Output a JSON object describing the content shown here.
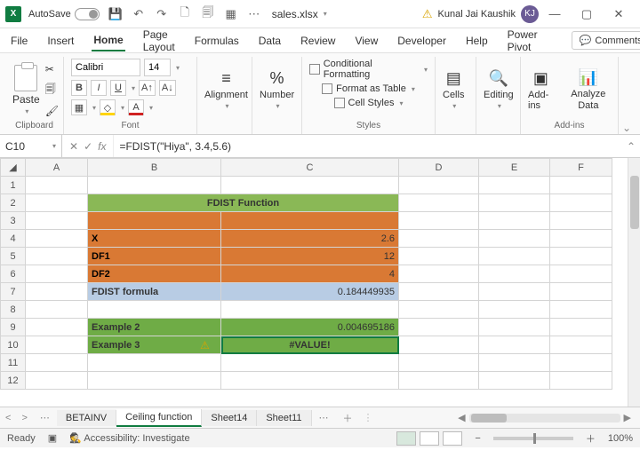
{
  "titlebar": {
    "autosave": "AutoSave",
    "autosave_state": "Off",
    "filename": "sales.xlsx",
    "user_name": "Kunal Jai Kaushik",
    "user_initials": "KJ"
  },
  "tabs": {
    "file": "File",
    "insert": "Insert",
    "home": "Home",
    "pagelayout": "Page Layout",
    "formulas": "Formulas",
    "data": "Data",
    "review": "Review",
    "view": "View",
    "developer": "Developer",
    "help": "Help",
    "powerpivot": "Power Pivot",
    "comments": "Comments"
  },
  "ribbon": {
    "clipboard": {
      "paste": "Paste",
      "label": "Clipboard"
    },
    "font": {
      "name": "Calibri",
      "size": "14",
      "label": "Font"
    },
    "alignment": {
      "label": "Alignment"
    },
    "number": {
      "label": "Number"
    },
    "styles": {
      "cond": "Conditional Formatting",
      "table": "Format as Table",
      "cell": "Cell Styles",
      "label": "Styles"
    },
    "cells": {
      "cells": "Cells",
      "label": "Cells"
    },
    "editing": {
      "editing": "Editing",
      "label": "Editing"
    },
    "addins": {
      "addins": "Add-ins",
      "analyze": "Analyze Data",
      "label": "Add-ins"
    }
  },
  "formula_bar": {
    "cell_ref": "C10",
    "formula": "=FDIST(\"Hiya\", 3.4,5.6)"
  },
  "columns": [
    "A",
    "B",
    "C",
    "D",
    "E",
    "F"
  ],
  "cells": {
    "title": "FDIST Function",
    "x_label": "X",
    "x_val": "2.6",
    "df1_label": "DF1",
    "df1_val": "12",
    "df2_label": "DF2",
    "df2_val": "4",
    "formula_label": "FDIST formula",
    "formula_val": "0.184449935",
    "ex2_label": "Example 2",
    "ex2_val": "0.004695186",
    "ex3_label": "Example 3",
    "ex3_val": "#VALUE!"
  },
  "sheets": {
    "s1": "BETAINV",
    "s2": "Ceiling function",
    "s3": "Sheet14",
    "s4": "Sheet11"
  },
  "status": {
    "ready": "Ready",
    "access": "Accessibility: Investigate",
    "zoom": "100%"
  }
}
